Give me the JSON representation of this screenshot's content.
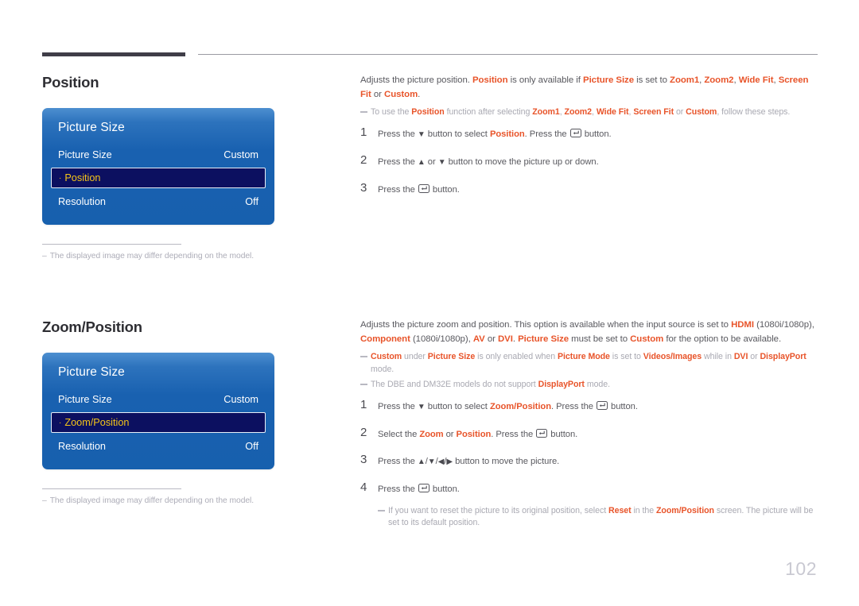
{
  "page": {
    "number": "102"
  },
  "sections": [
    {
      "id": "position",
      "heading": "Position",
      "osd": {
        "title": "Picture Size",
        "rows": [
          {
            "label": "Picture Size",
            "value": "Custom",
            "selected": false
          },
          {
            "label": "Position",
            "value": "",
            "selected": true,
            "bullet": "·"
          },
          {
            "label": "Resolution",
            "value": "Off",
            "selected": false
          }
        ]
      },
      "footnote": {
        "dash": "–",
        "text": "The displayed image may differ depending on the model."
      },
      "intro": "Adjusts the picture position. Position is only available if Picture Size is set to Zoom1, Zoom2, Wide Fit, Screen Fit or Custom.",
      "notes": [
        "To use the Position function after selecting Zoom1, Zoom2, Wide Fit, Screen Fit or Custom, follow these steps."
      ],
      "steps": [
        {
          "num": "1",
          "text": "Press the ▼ button to select Position. Press the ⏎ button."
        },
        {
          "num": "2",
          "text": "Press the ▲ or ▼ button to move the picture up or down."
        },
        {
          "num": "3",
          "text": "Press the ⏎ button."
        }
      ]
    },
    {
      "id": "zoomposition",
      "heading": "Zoom/Position",
      "osd": {
        "title": "Picture Size",
        "rows": [
          {
            "label": "Picture Size",
            "value": "Custom",
            "selected": false
          },
          {
            "label": "Zoom/Position",
            "value": "",
            "selected": true,
            "bullet": "·"
          },
          {
            "label": "Resolution",
            "value": "Off",
            "selected": false
          }
        ]
      },
      "footnote": {
        "dash": "–",
        "text": "The displayed image may differ depending on the model."
      },
      "intro": "Adjusts the picture zoom and position. This option is available when the input source is set to HDMI (1080i/1080p), Component (1080i/1080p), AV or DVI. Picture Size must be set to Custom for the option to be available.",
      "notes": [
        "Custom under Picture Size is only enabled when Picture Mode is set to Videos/Images while in DVI or DisplayPort mode.",
        "The DBE and DM32E models do not support DisplayPort mode."
      ],
      "steps": [
        {
          "num": "1",
          "text": "Press the ▼ button to select Zoom/Position. Press the ⏎ button."
        },
        {
          "num": "2",
          "text": "Select the Zoom or Position. Press the ⏎ button."
        },
        {
          "num": "3",
          "text": "Press the ▲/▼/◀/▶ button to move the picture."
        },
        {
          "num": "4",
          "text": "Press the ⏎ button."
        }
      ],
      "sub_note": "If you want to reset the picture to its original position, select Reset in the Zoom/Position screen. The picture will be set to its default position."
    }
  ],
  "colors": {
    "accent": "#e8542a",
    "osd_blue_top": "#4d8fd0",
    "osd_blue_bottom": "#1760ae",
    "osd_highlight": "#0c1060",
    "osd_highlight_text": "#f5c518",
    "rule_dark": "#3f3d48",
    "body_text": "#59595f",
    "muted_text": "#a9a9b2"
  }
}
